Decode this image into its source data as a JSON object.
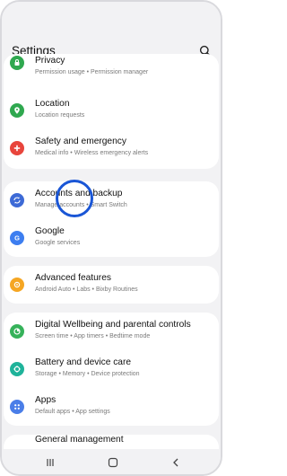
{
  "header": {
    "title": "Settings",
    "search_icon": "search-icon"
  },
  "rows": {
    "privacy": {
      "title": "Privacy",
      "subtitle": "Permission usage  •  Permission manager",
      "icon": "privacy-icon",
      "color": "#2fa84f"
    },
    "location": {
      "title": "Location",
      "subtitle": "Location requests",
      "icon": "location-pin-icon",
      "color": "#2fa84f"
    },
    "safety": {
      "title": "Safety and emergency",
      "subtitle": "Medical info  •  Wireless emergency alerts",
      "icon": "safety-icon",
      "color": "#e8453c"
    },
    "accounts": {
      "title": "Accounts and backup",
      "subtitle": "Manage accounts  •  Smart Switch",
      "icon": "sync-icon",
      "color": "#3d6ad6"
    },
    "google": {
      "title": "Google",
      "subtitle": "Google services",
      "icon": "google-icon",
      "color": "#3d7ef0"
    },
    "advanced": {
      "title": "Advanced features",
      "subtitle": "Android Auto  •  Labs  •  Bixby Routines",
      "icon": "star-gear-icon",
      "color": "#f5a623"
    },
    "wellbeing": {
      "title": "Digital Wellbeing and parental controls",
      "subtitle": "Screen time  •  App timers  •  Bedtime mode",
      "icon": "wellbeing-icon",
      "color": "#36b25a"
    },
    "battery": {
      "title": "Battery and device care",
      "subtitle": "Storage  •  Memory  •  Device protection",
      "icon": "device-care-icon",
      "color": "#1fb39a"
    },
    "apps": {
      "title": "Apps",
      "subtitle": "Default apps  •  App settings",
      "icon": "apps-grid-icon",
      "color": "#4a7ee8"
    }
  },
  "partial_row_title": "General management",
  "navbar": {
    "recents": "recents-icon",
    "home": "home-icon",
    "back": "back-icon"
  },
  "touch_indicator": "touch-indicator"
}
